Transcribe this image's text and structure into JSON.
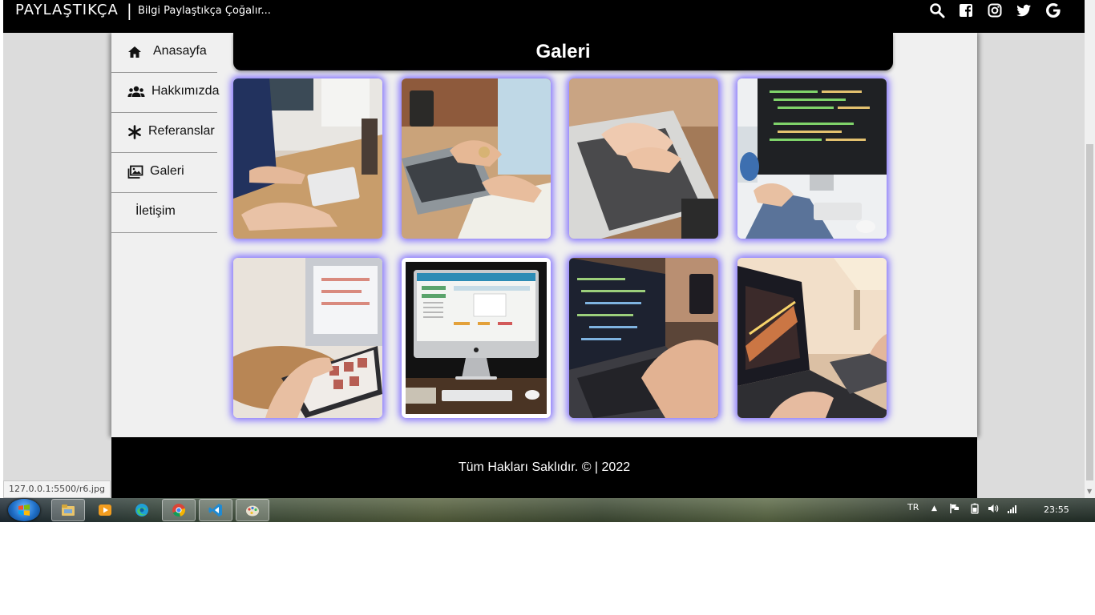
{
  "browser": {
    "status_url": "127.0.0.1:5500/r6.jpg"
  },
  "header": {
    "brand": "PAYLAŞTIKÇA",
    "separator": "|",
    "tagline": "Bilgi Paylaştıkça Çoğalır..."
  },
  "social_icons": [
    "search-icon",
    "facebook-icon",
    "instagram-icon",
    "twitter-icon",
    "google-icon"
  ],
  "sidebar": {
    "items": [
      {
        "label": "Anasayfa",
        "icon": "home-icon"
      },
      {
        "label": "Hakkımızda",
        "icon": "users-icon"
      },
      {
        "label": "Referanslar",
        "icon": "asterisk-icon"
      },
      {
        "label": "Galeri",
        "icon": "images-icon"
      },
      {
        "label": "İletişim",
        "icon": ""
      }
    ]
  },
  "gallery": {
    "title": "Galeri",
    "images": [
      {
        "subject": "office-keyboards"
      },
      {
        "subject": "laptop-watch-desk"
      },
      {
        "subject": "laptop-typing"
      },
      {
        "subject": "imac-code"
      },
      {
        "subject": "tablet-browsing"
      },
      {
        "subject": "imac-dashboard",
        "hovered": true
      },
      {
        "subject": "laptop-code-dark"
      },
      {
        "subject": "laptop-lamp"
      }
    ]
  },
  "footer": {
    "text": "Tüm Hakları Saklıdır. © | 2022"
  },
  "taskbar": {
    "language": "TR",
    "clock": "23:55",
    "apps": [
      "start-button",
      "explorer-icon",
      "media-player-icon",
      "edge-icon",
      "chrome-icon",
      "vscode-icon",
      "paint-icon"
    ]
  },
  "colors": {
    "header_bg": "#000000",
    "content_bg": "#f0f0f0",
    "tile_glow": "#6e5aff",
    "footer_bg": "#000000"
  }
}
